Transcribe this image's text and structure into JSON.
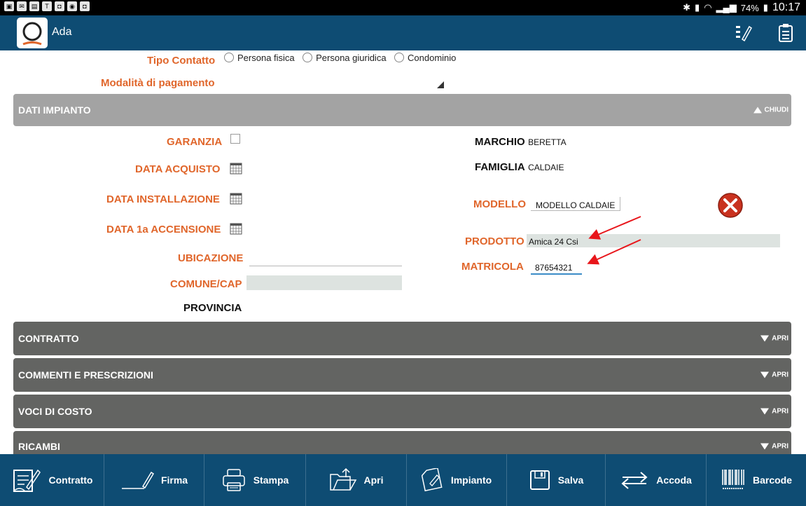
{
  "status_bar": {
    "battery": "74%",
    "time": "10:17"
  },
  "app_bar": {
    "title": "Ada",
    "icons": [
      "edit-list-icon",
      "clipboard-icon"
    ]
  },
  "contact": {
    "tipo_label": "Tipo Contatto",
    "options": [
      "Persona fisica",
      "Persona giuridica",
      "Condominio"
    ],
    "payment_label": "Modalità di pagamento"
  },
  "sections": {
    "impianto": {
      "title": "DATI IMPIANTO",
      "action": "CHIUDI",
      "expanded": true
    },
    "contratto": {
      "title": "CONTRATTO",
      "action": "APRI"
    },
    "commenti": {
      "title": "COMMENTI E PRESCRIZIONI",
      "action": "APRI"
    },
    "voci": {
      "title": "VOCI DI COSTO",
      "action": "APRI"
    },
    "ricambi": {
      "title": "RICAMBI",
      "action": "APRI"
    }
  },
  "impianto": {
    "garanzia_label": "GARANZIA",
    "data_acquisto_label": "DATA ACQUISTO",
    "data_installazione_label": "DATA INSTALLAZIONE",
    "data_accensione_label": "DATA 1a ACCENSIONE",
    "ubicazione_label": "UBICAZIONE",
    "comune_label": "COMUNE/CAP",
    "provincia_label": "PROVINCIA",
    "marchio_label": "MARCHIO",
    "marchio_value": "BERETTA",
    "famiglia_label": "FAMIGLIA",
    "famiglia_value": "CALDAIE",
    "modello_label": "MODELLO",
    "modello_value": "MODELLO CALDAIE",
    "prodotto_label": "PRODOTTO",
    "prodotto_value": "Amica 24 Csi",
    "matricola_label": "MATRICOLA",
    "matricola_value": "87654321"
  },
  "toolbar": {
    "buttons": [
      "Contratto",
      "Firma",
      "Stampa",
      "Apri",
      "Impianto",
      "Salva",
      "Accoda",
      "Barcode"
    ]
  },
  "colors": {
    "app_bar": "#0e4c73",
    "label_accent": "#e0662b",
    "section_expanded": "#a3a3a3",
    "section_collapsed": "#636462",
    "annotation_arrow": "#e8161b"
  }
}
